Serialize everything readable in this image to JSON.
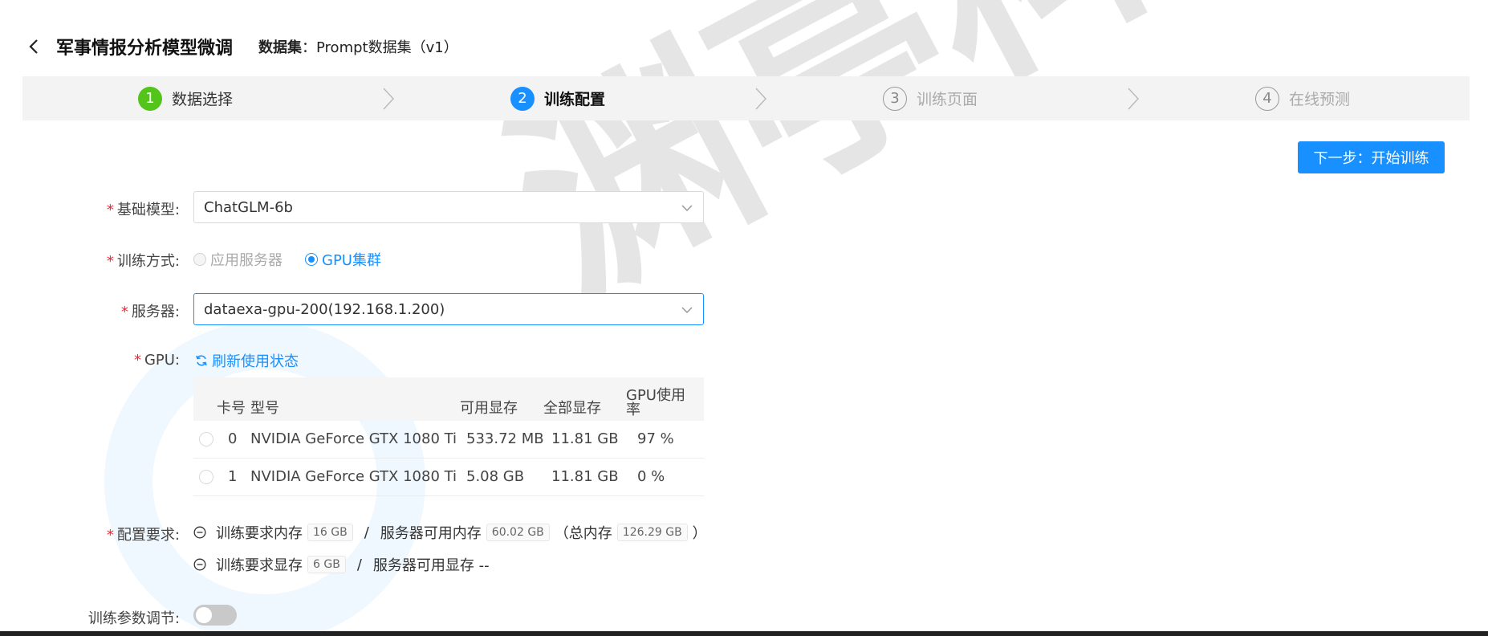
{
  "header": {
    "title": "军事情报分析模型微调",
    "dataset_label": "数据集",
    "dataset_value": "：Prompt数据集（v1）"
  },
  "steps": [
    {
      "num": "1",
      "label": "数据选择",
      "state": "done"
    },
    {
      "num": "2",
      "label": "训练配置",
      "state": "active"
    },
    {
      "num": "3",
      "label": "训练页面",
      "state": "pending"
    },
    {
      "num": "4",
      "label": "在线预测",
      "state": "pending"
    }
  ],
  "next_button": "下一步：开始训练",
  "form": {
    "base_model": {
      "label": "基础模型:",
      "value": "ChatGLM-6b"
    },
    "train_mode": {
      "label": "训练方式:",
      "options": [
        "应用服务器",
        "GPU集群"
      ],
      "selected": "GPU集群"
    },
    "server": {
      "label": "服务器:",
      "value": "dataexa-gpu-200(192.168.1.200)"
    },
    "gpu": {
      "label": "GPU:",
      "refresh": "刷新使用状态"
    },
    "config": {
      "label": "配置要求:",
      "mem_req_label": "训练要求内存",
      "mem_req": "16 GB",
      "mem_avail_label": "服务器可用内存",
      "mem_avail": "60.02 GB",
      "mem_total_open": "（总内存",
      "mem_total": "126.29 GB",
      "mem_total_close": "）",
      "vram_req_label": "训练要求显存",
      "vram_req": "6 GB",
      "vram_avail_label": "服务器可用显存 --",
      "separator": "/"
    },
    "params": {
      "label": "训练参数调节:"
    }
  },
  "gpu_table": {
    "headers": {
      "card": "卡号",
      "model": "型号",
      "avail": "可用显存",
      "total": "全部显存",
      "usage_line1": "GPU使用",
      "usage_line2": "率"
    },
    "rows": [
      {
        "card": "0",
        "model": "NVIDIA GeForce GTX 1080 Ti",
        "avail": "533.72 MB",
        "total": "11.81 GB",
        "usage": "97 %"
      },
      {
        "card": "1",
        "model": "NVIDIA GeForce GTX 1080 Ti",
        "avail": "5.08 GB",
        "total": "11.81 GB",
        "usage": "0 %"
      }
    ]
  },
  "watermark": "渊亭科技",
  "colors": {
    "primary": "#1890ff",
    "success": "#52c41a",
    "required": "#f5222d"
  }
}
